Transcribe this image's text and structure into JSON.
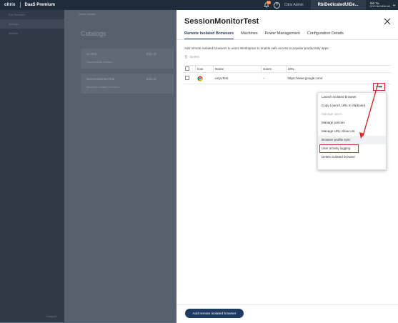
{
  "topbar": {
    "logo": "citrix",
    "product": "DaaS Premium",
    "notification_count": "99",
    "citrix_admin": "Citrix Admin",
    "tenant": "RbiDedicatedUIDe...",
    "user_name": "Xin Yu",
    "user_org": "OOO 8b7c85b1d6"
  },
  "background": {
    "nav_items": [
      "Full Services",
      "Manage",
      "Monitor"
    ],
    "collapse_label": "Collapse",
    "crumb": "Quick Deploy",
    "page_title": "Catalogs",
    "cards": [
      {
        "name": "UI Test",
        "edit": "Edit UI",
        "status": "Successfully created"
      },
      {
        "name": "SessionMonitorTest",
        "edit": "Edit UI",
        "status": "Machine created  •  Actions"
      }
    ]
  },
  "drawer": {
    "title": "SessionMonitorTest",
    "tabs": [
      "Remote Isolated Browsers",
      "Machines",
      "Power Management",
      "Configuration Details"
    ],
    "active_tab": "Remote Isolated Browsers",
    "description": "Add remote isolated browsers to users Workspace to enable safe access to popular productivity apps.",
    "delete_label": "Delete",
    "table": {
      "headers": [
        "Icon",
        "Name",
        "Users",
        "URL"
      ],
      "rows": [
        {
          "icon": "chrome-icon",
          "name": "xinyuTest",
          "users": "--",
          "url": "https://www.google.com/"
        }
      ]
    },
    "more_label": "•••",
    "menu": [
      {
        "label": "Launch isolated browser",
        "state": "normal"
      },
      {
        "label": "Copy Launch URL to clipboard",
        "state": "normal"
      },
      {
        "label": "Manage users",
        "state": "disabled"
      },
      {
        "label": "Manage policies",
        "state": "normal"
      },
      {
        "label": "Manage URL Allow List",
        "state": "normal"
      },
      {
        "label": "Browser profile sync",
        "state": "hover"
      },
      {
        "label": "User activity logging",
        "state": "highlight"
      },
      {
        "label": "Delete isolated browser",
        "state": "normal"
      }
    ],
    "add_button": "Add remote isolated browser"
  },
  "colors": {
    "accent": "#1f3a5f",
    "annotation": "#d42a2a",
    "topbar": "#1f2c3a",
    "badge": "#e9742f"
  }
}
